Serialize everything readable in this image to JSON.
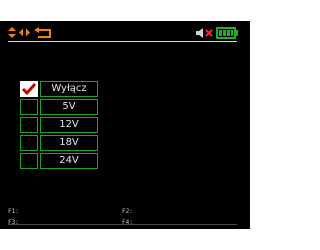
{
  "status_bar": {
    "icons": [
      "up-down-arrows-icon",
      "left-arrow-icon",
      "right-arrow-icon",
      "return-icon",
      "speaker-muted-icon",
      "battery-icon"
    ],
    "colors": {
      "nav": "#f0820a",
      "mute": "#ff2020",
      "battery": "#22b022"
    }
  },
  "options": [
    {
      "label": "Wyłącz",
      "selected": true
    },
    {
      "label": "5V",
      "selected": false
    },
    {
      "label": "12V",
      "selected": false
    },
    {
      "label": "18V",
      "selected": false
    },
    {
      "label": "24V",
      "selected": false
    }
  ],
  "function_keys": {
    "f1": "F1:",
    "f2": "F2:",
    "f3": "F3:",
    "f4": "F4:"
  },
  "colors": {
    "frame": "#1ea51e",
    "background": "#000000",
    "text": "#e6e6e6"
  }
}
